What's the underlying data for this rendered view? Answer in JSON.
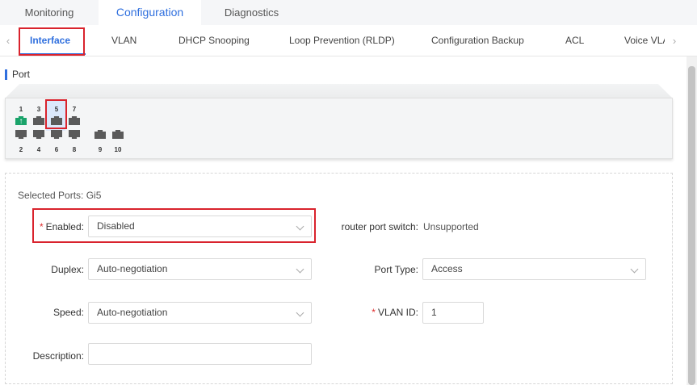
{
  "top_tabs": [
    "Monitoring",
    "Configuration",
    "Diagnostics"
  ],
  "sub_nav": {
    "left_arrow": "‹",
    "right_arrow": "›",
    "tabs": [
      "Interface",
      "VLAN",
      "DHCP Snooping",
      "Loop Prevention (RLDP)",
      "Configuration Backup",
      "ACL",
      "Voice VLAN"
    ]
  },
  "section_title": "Port",
  "ports": {
    "top_numbers": [
      "1",
      "3",
      "5",
      "7"
    ],
    "bottom_numbers": [
      "2",
      "4",
      "6",
      "8",
      "9",
      "10"
    ],
    "uplink_glyph": "↑"
  },
  "form": {
    "selected_ports": "Selected Ports: Gi5",
    "enabled": {
      "label": "Enabled",
      "value": "Disabled"
    },
    "router_port_switch": {
      "label": "router port switch",
      "value": "Unsupported"
    },
    "duplex": {
      "label": "Duplex",
      "value": "Auto-negotiation"
    },
    "port_type": {
      "label": "Port Type",
      "value": "Access"
    },
    "speed": {
      "label": "Speed",
      "value": "Auto-negotiation"
    },
    "vlan_id": {
      "label": "VLAN ID",
      "value": "1"
    },
    "description": {
      "label": "Description",
      "value": ""
    },
    "required_mark": "*",
    "colon": ":"
  },
  "colors": {
    "accent": "#2f6fde",
    "highlight": "#d9232d",
    "port_up": "#1aa36a",
    "port": "#5a5a5a"
  }
}
